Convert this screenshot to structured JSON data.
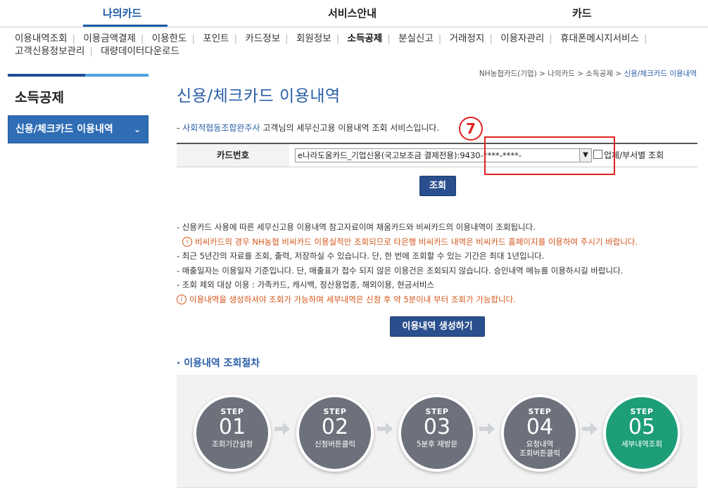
{
  "topnav": {
    "tabs": [
      {
        "label": "나의카드"
      },
      {
        "label": "서비스안내"
      },
      {
        "label": "카드"
      }
    ]
  },
  "submenu": {
    "items": [
      "이용내역조회",
      "이용금액결제",
      "이용한도",
      "포인트",
      "카드정보",
      "회원정보",
      "소득공제",
      "분실신고",
      "거래정지",
      "이용자관리",
      "휴대폰메시지서비스",
      "고객신용정보관리",
      "대량데이터다운로드"
    ]
  },
  "sidebar": {
    "title": "소득공제",
    "menu_label": "신용/체크카드 이용내역",
    "chevron": "⌄"
  },
  "breadcrumb": {
    "path": "NH농협카드(기업) > 나의카드 > 소득공제 > ",
    "current": "신용/체크카드 이용내역"
  },
  "page": {
    "title": "신용/체크카드 이용내역",
    "intro_prefix": "- ",
    "intro_company": "사회적협동조합완주사",
    "intro_suffix": " 고객님의 세무신고용 이용내역 조회 서비스입니다."
  },
  "card_form": {
    "label": "카드번호",
    "selected": "e나라도움카드_기업신용(국고보조금 결제전용):9430-****-****-",
    "checkbox_label": "업체/부서별 조회",
    "annotation": "7"
  },
  "buttons": {
    "query": "조회",
    "generate": "이용내역 생성하기"
  },
  "notes": [
    {
      "type": "normal",
      "text": "- 신용카드 사용에 따른 세무신고용 이용내역 참고자료이며 채움카드와 비씨카드의 이용내역이 조회됩니다."
    },
    {
      "type": "warn-indent",
      "text": "비씨카드의 경우 NH농협 비씨카드 이용실적만 조회되므로 타은행 비씨카드 내역은 비씨카드 홈페이지를 이용하여 주시기 바랍니다."
    },
    {
      "type": "normal",
      "text": "- 최근 5년간의 자료를 조회, 출력, 저장하실 수 있습니다. 단, 한 번에 조회할 수 있는 기간은 최대 1년입니다."
    },
    {
      "type": "normal",
      "text": "- 매출일자는 이용일자 기준입니다. 단, 매출표가 접수 되지 않은 이용건은 조회되지 않습니다. 승인내역 메뉴를 이용하시길 바랍니다."
    },
    {
      "type": "normal",
      "text": "- 조회 제외 대상 이용 : 가족카드, 캐시백, 정산용업종, 해외이용, 현금서비스"
    },
    {
      "type": "warn",
      "text": "이용내역을 생성하셔야 조회가 가능하며 세부내역은 신청 후 약 5분이내 부터 조회가 가능합니다."
    }
  ],
  "section": {
    "title": "· 이용내역 조회절차"
  },
  "steps": [
    {
      "label": "STEP",
      "num": "01",
      "desc": "조회기간설정"
    },
    {
      "label": "STEP",
      "num": "02",
      "desc": "신청버튼클릭"
    },
    {
      "label": "STEP",
      "num": "03",
      "desc": "5분후 재방문"
    },
    {
      "label": "STEP",
      "num": "04",
      "desc": "요청내역\n조회버튼클릭"
    },
    {
      "label": "STEP",
      "num": "05",
      "desc": "세부내역조회"
    }
  ],
  "colors": {
    "accent": "#2a5fa8",
    "nav_blue": "#1a5aa6",
    "button": "#2a4f8e",
    "warn": "#d3561a",
    "annotation": "#e0221e",
    "step_gray": "#6c717c",
    "step_green": "#1e9e78"
  }
}
